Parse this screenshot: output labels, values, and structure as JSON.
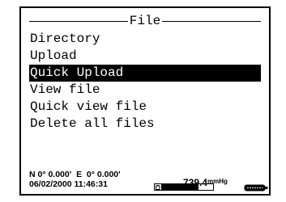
{
  "screen": {
    "title": "File",
    "menu_items": [
      {
        "label": "Directory",
        "selected": false
      },
      {
        "label": "Upload",
        "selected": false
      },
      {
        "label": "Quick Upload",
        "selected": true
      },
      {
        "label": "View file",
        "selected": false
      },
      {
        "label": "Quick view file",
        "selected": false
      },
      {
        "label": "Delete all files",
        "selected": false
      }
    ]
  },
  "status_bar": {
    "gps": "N 0° 0.000'  E  0° 0.000'",
    "datetime": "06/02/2000 11:46:31",
    "pressure_value": "739.4",
    "pressure_unit": "mmHg",
    "battery_level": 0.72,
    "battery_icon": "battery-icon",
    "sonde_icon": "sonde-icon"
  },
  "colors": {
    "foreground": "#000000",
    "background": "#ffffff",
    "highlight": "#000000",
    "highlight_text": "#ffffff"
  }
}
